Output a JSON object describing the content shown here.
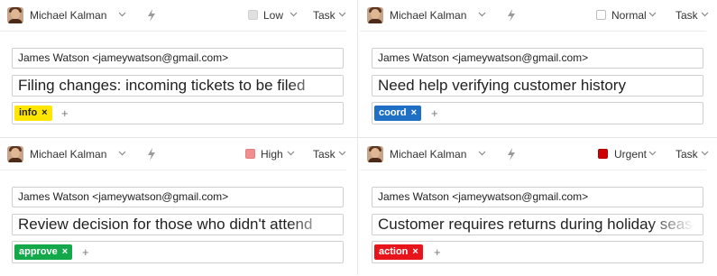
{
  "cards": [
    {
      "assignee": "Michael Kalman",
      "priority": {
        "label": "Low",
        "color": "#e0e0e0",
        "border": "#d0d0d0"
      },
      "type_label": "Task",
      "from": "James Watson <jameywatson@gmail.com>",
      "subject": "Filing changes: incoming tickets to be filed",
      "tag": {
        "label": "info",
        "remove": "×",
        "bg": "#ffe600",
        "fg": "#222"
      },
      "add": "+"
    },
    {
      "assignee": "Michael Kalman",
      "priority": {
        "label": "Normal",
        "color": "#ffffff",
        "border": "#bdbdbd"
      },
      "type_label": "Task",
      "from": "James Watson <jameywatson@gmail.com>",
      "subject": "Need help verifying customer history",
      "tag": {
        "label": "coord",
        "remove": "×",
        "bg": "#1f6fc5",
        "fg": "#fff"
      },
      "add": "+"
    },
    {
      "assignee": "Michael Kalman",
      "priority": {
        "label": "High",
        "color": "#f08f8f",
        "border": "#e58080"
      },
      "type_label": "Task",
      "from": "James Watson <jameywatson@gmail.com>",
      "subject": "Review decision for those who didn't attend",
      "tag": {
        "label": "approve",
        "remove": "×",
        "bg": "#13a94a",
        "fg": "#fff"
      },
      "add": "+"
    },
    {
      "assignee": "Michael Kalman",
      "priority": {
        "label": "Urgent",
        "color": "#cc0000",
        "border": "#b00000"
      },
      "type_label": "Task",
      "from": "James Watson <jameywatson@gmail.com>",
      "subject": "Customer requires returns during holiday season",
      "tag": {
        "label": "action",
        "remove": "×",
        "bg": "#e8141c",
        "fg": "#fff"
      },
      "add": "+"
    }
  ]
}
